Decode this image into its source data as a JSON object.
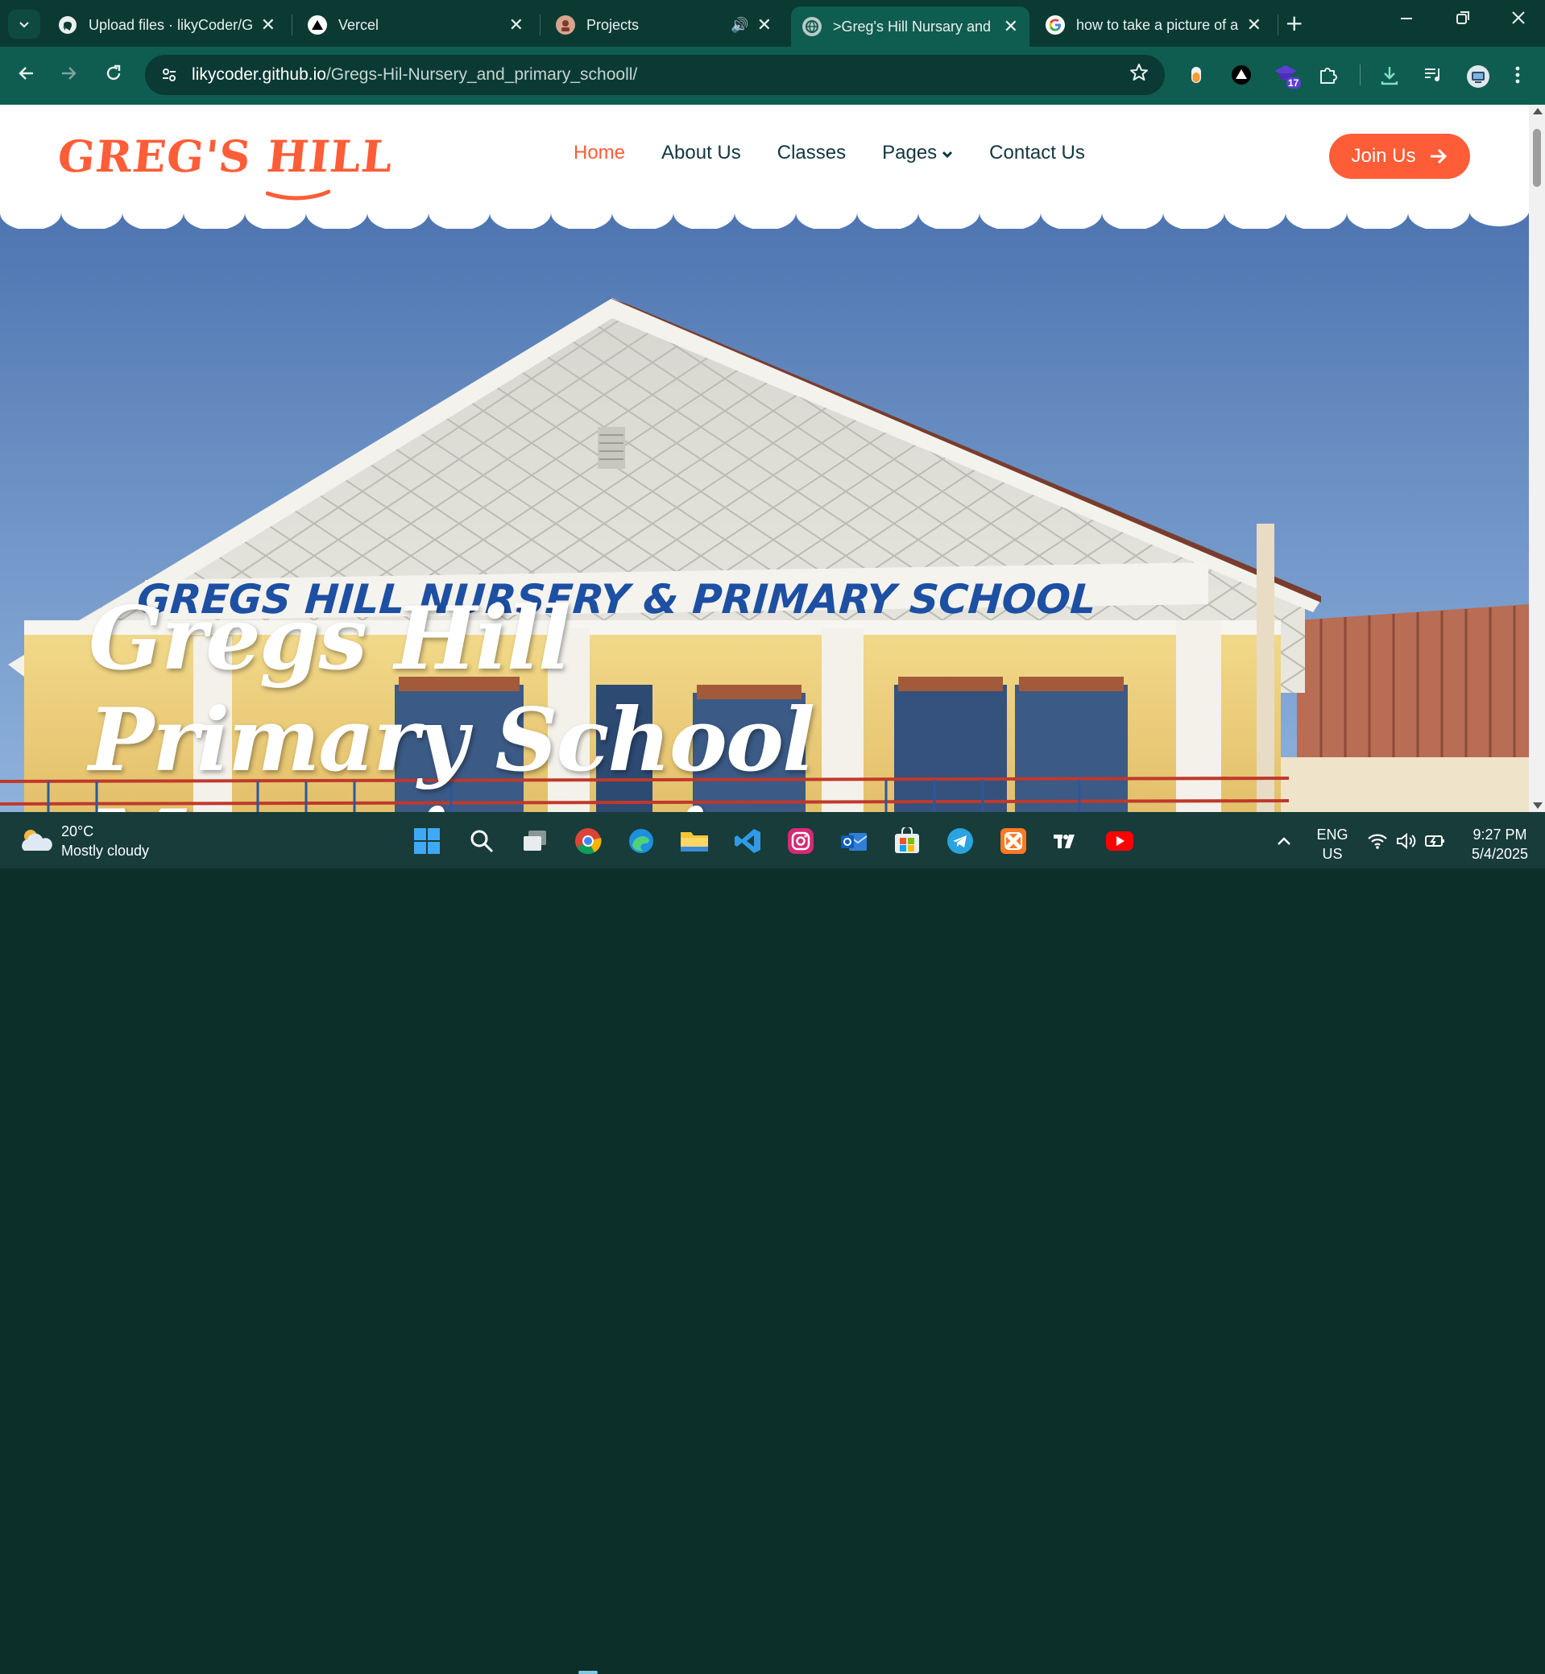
{
  "browser": {
    "tabs": [
      {
        "title": "Upload files · likyCoder/G",
        "icon": "github-icon",
        "close": "✕"
      },
      {
        "title": "Vercel",
        "icon": "vercel-icon",
        "close": "✕"
      },
      {
        "title": "Projects",
        "icon": "avatar-icon",
        "close": "✕",
        "audio": "🔊"
      },
      {
        "title": ">Greg's Hill Nursary and",
        "icon": "globe-icon",
        "close": "✕"
      },
      {
        "title": "how to take a picture of a",
        "icon": "google-icon",
        "close": "✕"
      }
    ],
    "new_tab": "+",
    "url_host": "likycoder.github.io",
    "url_path": "/Gregs-Hil-Nursery_and_primary_schooll/",
    "extension_badge": "17"
  },
  "site": {
    "logo": "GREG'S HILL",
    "nav": [
      "Home",
      "About Us",
      "Classes",
      "Pages",
      "Contact Us"
    ],
    "join_label": "Join Us",
    "hero_title": "Gregs Hill Primary School Maganjo main Blanch.",
    "building_sign": "GREGS HILL NURSERY & PRIMARY SCHOOL",
    "accent_color": "#fe5d37"
  },
  "taskbar": {
    "temperature": "20°C",
    "weather": "Mostly cloudy",
    "lang": "ENG",
    "region": "US",
    "time": "9:27 PM",
    "date": "5/4/2025"
  }
}
